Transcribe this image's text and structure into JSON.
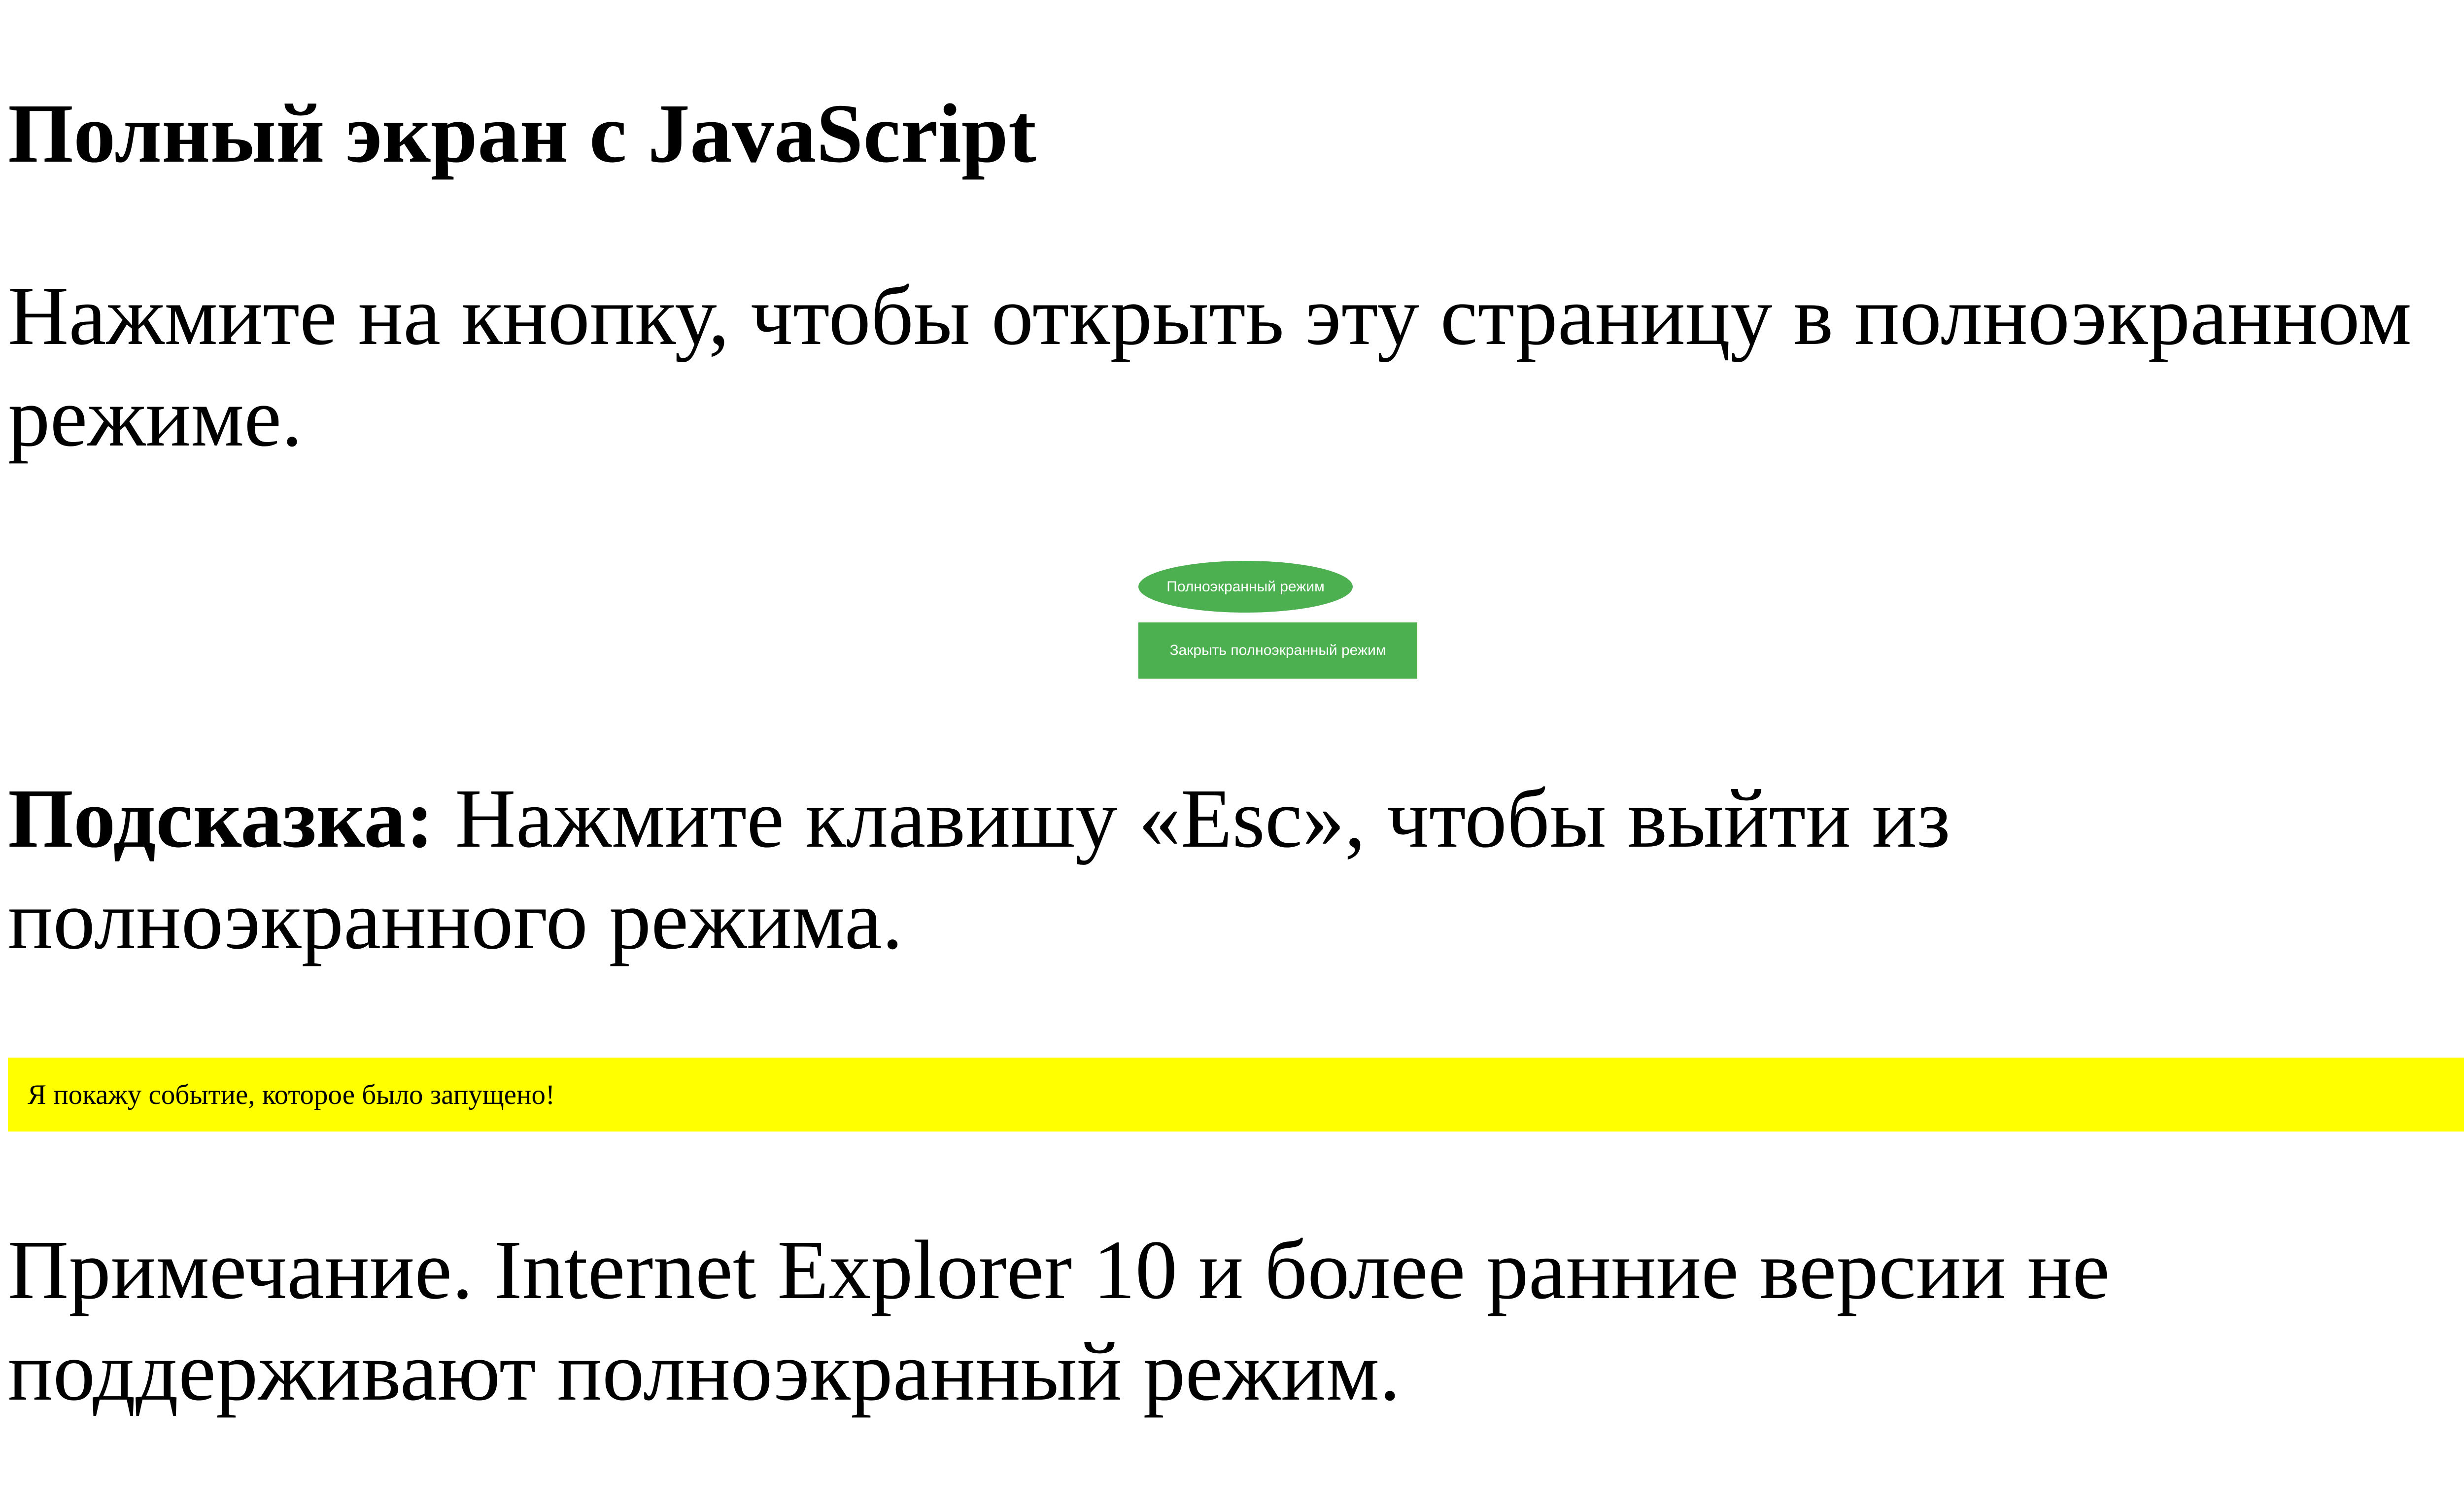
{
  "page": {
    "title": "Полный экран с JavaScript",
    "intro": "Нажмите на кнопку, чтобы открыть эту страницу в полноэкранном режиме.",
    "buttons": {
      "open_label": "Полноэкранный режим",
      "close_label": "Закрыть полноэкранный режим"
    },
    "tip": {
      "label": "Подсказка:",
      "text": " Нажмите клавишу «Esc», чтобы выйти из полноэкранного режима."
    },
    "event_box": {
      "text": "Я покажу событие, которое было запущено!"
    },
    "note": "Примечание. Internet Explorer 10 и более ранние версии не поддерживают полноэкранный режим."
  },
  "colors": {
    "button": "#4caf50",
    "button_text": "#ffffff",
    "event_box_background": "#ffff00",
    "page_background": "#ffffff",
    "text": "#000000"
  }
}
